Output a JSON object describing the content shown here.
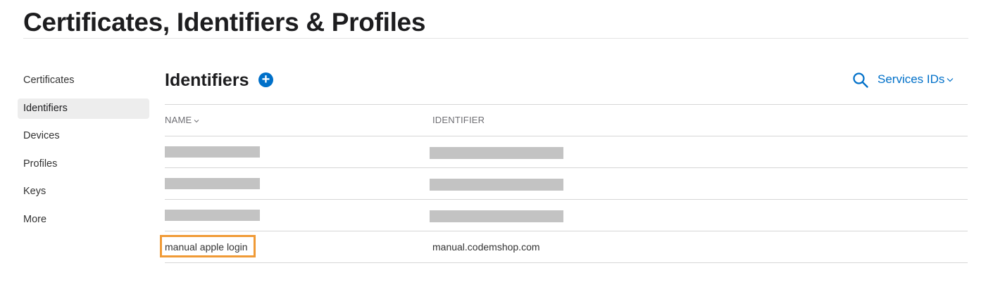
{
  "page": {
    "title": "Certificates, Identifiers & Profiles"
  },
  "sidebar": {
    "items": [
      {
        "label": "Certificates",
        "active": false
      },
      {
        "label": "Identifiers",
        "active": true
      },
      {
        "label": "Devices",
        "active": false
      },
      {
        "label": "Profiles",
        "active": false
      },
      {
        "label": "Keys",
        "active": false
      },
      {
        "label": "More",
        "active": false
      }
    ]
  },
  "main": {
    "section_title": "Identifiers",
    "add_icon": "plus-circle-icon",
    "search_icon": "search-icon",
    "filter": {
      "selected": "Services IDs",
      "icon": "chevron-down-icon"
    },
    "table": {
      "columns": [
        {
          "label": "NAME",
          "sortable": true
        },
        {
          "label": "IDENTIFIER",
          "sortable": false
        }
      ],
      "rows": [
        {
          "name": "",
          "identifier": "",
          "redacted": true
        },
        {
          "name": "",
          "identifier": "",
          "redacted": true
        },
        {
          "name": "",
          "identifier": "",
          "redacted": true
        },
        {
          "name": "manual apple login",
          "identifier": "manual.codemshop.com",
          "redacted": false,
          "highlighted": true
        }
      ]
    }
  },
  "colors": {
    "accent": "#0070c9",
    "highlight": "#f09a36",
    "redaction": "#c3c3c3",
    "active_bg": "#ededed"
  }
}
